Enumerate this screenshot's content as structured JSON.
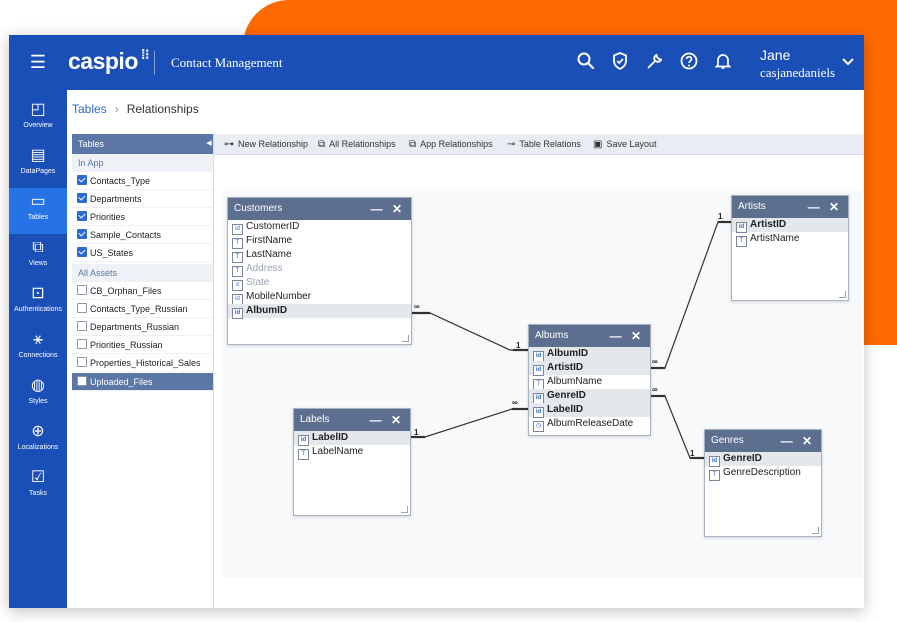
{
  "header": {
    "logo": "caspio",
    "app_title": "Contact Management",
    "user": {
      "name": "Jane",
      "login": "casjanedaniels"
    },
    "icons": [
      "search-icon",
      "shield-icon",
      "wrench-icon",
      "help-icon",
      "bell-icon",
      "chevron-down-icon"
    ]
  },
  "sidebar": {
    "items": [
      {
        "label": "Overview",
        "icon": "overview-icon"
      },
      {
        "label": "DataPages",
        "icon": "datapages-icon"
      },
      {
        "label": "Tables",
        "icon": "tables-icon",
        "active": true
      },
      {
        "label": "Views",
        "icon": "views-icon"
      },
      {
        "label": "Authentications",
        "icon": "authentications-icon"
      },
      {
        "label": "Connections",
        "icon": "connections-icon"
      },
      {
        "label": "Styles",
        "icon": "styles-icon"
      },
      {
        "label": "Localizations",
        "icon": "globe-icon"
      },
      {
        "label": "Tasks",
        "icon": "tasks-icon"
      }
    ]
  },
  "breadcrumb": {
    "root": "Tables",
    "current": "Relationships"
  },
  "tree": {
    "header": "Tables",
    "section_in_app": "In App",
    "in_app": [
      {
        "label": "Contacts_Type",
        "checked": true
      },
      {
        "label": "Departments",
        "checked": true
      },
      {
        "label": "Priorities",
        "checked": true
      },
      {
        "label": "Sample_Contacts",
        "checked": true
      },
      {
        "label": "US_States",
        "checked": true
      }
    ],
    "section_all": "All Assets",
    "all_assets": [
      {
        "label": "CB_Orphan_Files",
        "checked": false
      },
      {
        "label": "Contacts_Type_Russian",
        "checked": false
      },
      {
        "label": "Departments_Russian",
        "checked": false
      },
      {
        "label": "Priorities_Russian",
        "checked": false
      },
      {
        "label": "Properties_Historical_Sales",
        "checked": false
      },
      {
        "label": "Uploaded_Files",
        "checked": false,
        "selected": true
      }
    ]
  },
  "toolbar": {
    "new_relationship": "New Relationship",
    "all_relationships": "All Relationships",
    "app_relationships": "App Relationships",
    "table_relations": "Table Relations",
    "save_layout": "Save Layout"
  },
  "entities": {
    "customers": {
      "title": "Customers",
      "fields": [
        {
          "name": "CustomerID",
          "type": "id"
        },
        {
          "name": "FirstName",
          "type": "text"
        },
        {
          "name": "LastName",
          "type": "text"
        },
        {
          "name": "Address",
          "type": "text",
          "dim": true
        },
        {
          "name": "State",
          "type": "list",
          "dim": true
        },
        {
          "name": "MobileNumber",
          "type": "id"
        },
        {
          "name": "AlbumID",
          "type": "id",
          "key": true
        }
      ]
    },
    "artists": {
      "title": "Artists",
      "fields": [
        {
          "name": "ArtistID",
          "type": "id",
          "key": true
        },
        {
          "name": "ArtistName",
          "type": "text"
        }
      ]
    },
    "albums": {
      "title": "Albums",
      "fields": [
        {
          "name": "AlbumID",
          "type": "id",
          "key": true
        },
        {
          "name": "ArtistID",
          "type": "id",
          "key": true
        },
        {
          "name": "AlbumName",
          "type": "text"
        },
        {
          "name": "GenreID",
          "type": "id",
          "key": true
        },
        {
          "name": "LabelID",
          "type": "id",
          "key": true
        },
        {
          "name": "AlbumReleaseDate",
          "type": "date"
        }
      ]
    },
    "labels": {
      "title": "Labels",
      "fields": [
        {
          "name": "LabelID",
          "type": "id",
          "key": true
        },
        {
          "name": "LabelName",
          "type": "text"
        }
      ]
    },
    "genres": {
      "title": "Genres",
      "fields": [
        {
          "name": "GenreID",
          "type": "id",
          "key": true
        },
        {
          "name": "GenreDescription",
          "type": "text"
        }
      ]
    }
  },
  "relations": {
    "one": "1",
    "many": "∞"
  },
  "colors": {
    "brand": "#1b4fb8",
    "accent": "#ff6a00",
    "panel": "#5c77a6",
    "entity_header": "#5c6f8e"
  }
}
